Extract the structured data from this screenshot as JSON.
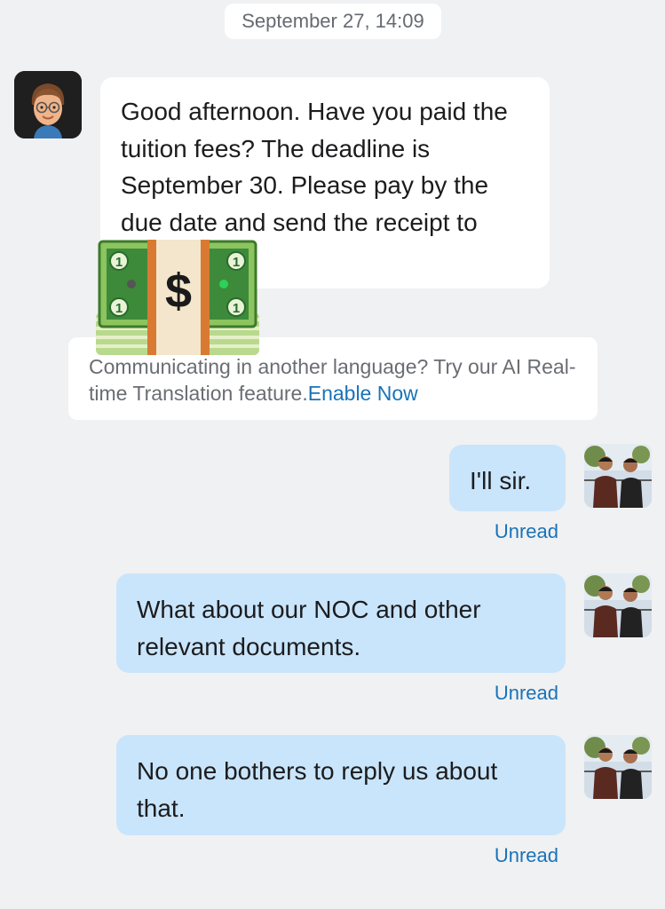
{
  "conversation": {
    "timestamp": "September 27, 14:09",
    "incoming": {
      "text": "Good afternoon. Have you paid the tuition fees? The deadline is September 30. Please pay by the due date and send the receipt to",
      "avatar_icon": "memoji-avatar-icon",
      "sticker_icon": "money-bag-icon",
      "sticker_symbol": "$",
      "sticker_denomination": "1"
    },
    "translation_bar": {
      "prompt": "Communicating in another language? Try our AI Real-time Translation feature.",
      "link": "Enable Now"
    },
    "outgoing": [
      {
        "text": "I'll sir.",
        "status": "Unread"
      },
      {
        "text": "What about our NOC and other relevant documents.",
        "status": "Unread"
      },
      {
        "text": "No one bothers to reply us about that.",
        "status": "Unread"
      }
    ]
  },
  "colors": {
    "background": "#f0f1f3",
    "outgoing_bubble": "#c9e5fb",
    "incoming_bubble": "#ffffff",
    "link": "#1a73b8"
  }
}
